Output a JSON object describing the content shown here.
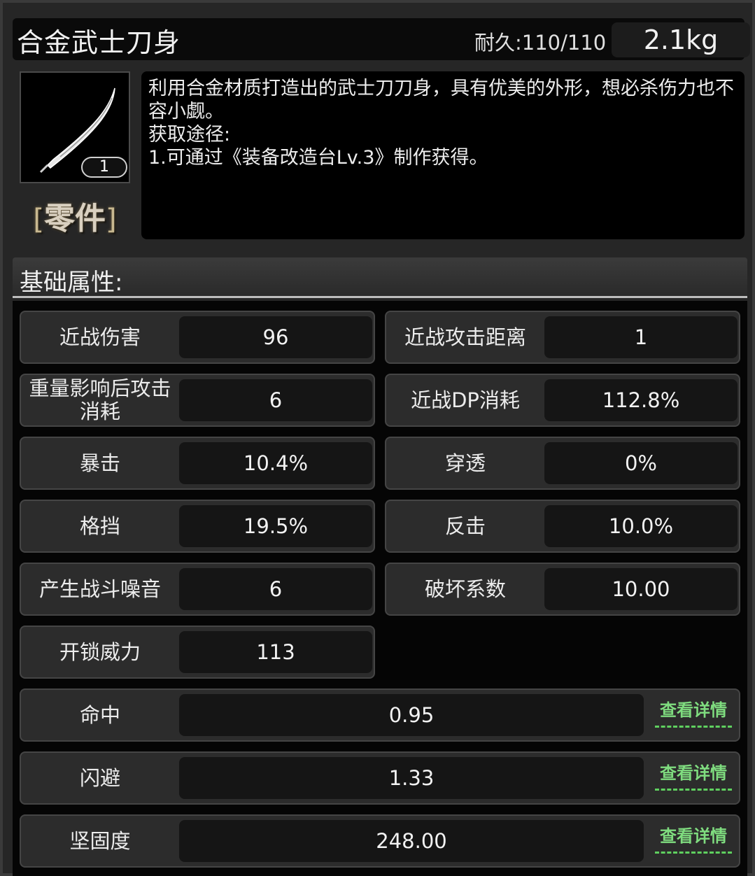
{
  "item": {
    "name": "合金武士刀身",
    "durability": "耐久:110/110",
    "weight": "2.1kg",
    "quantity": "1",
    "category_open": "[",
    "category": "零件",
    "category_close": "]",
    "description": "利用合金材质打造出的武士刀刀身，具有优美的外形，想必杀伤力也不容小觑。\n获取途径:\n1.可通过《装备改造台Lv.3》制作获得。",
    "icon": "katana-blade-icon"
  },
  "section": {
    "title": "基础属性:"
  },
  "stats": [
    {
      "label": "近战伤害",
      "value": "96"
    },
    {
      "label": "近战攻击距离",
      "value": "1"
    },
    {
      "label": "重量影响后攻击消耗",
      "value": "6"
    },
    {
      "label": "近战DP消耗",
      "value": "112.8%"
    },
    {
      "label": "暴击",
      "value": "10.4%"
    },
    {
      "label": "穿透",
      "value": "0%"
    },
    {
      "label": "格挡",
      "value": "19.5%"
    },
    {
      "label": "反击",
      "value": "10.0%"
    },
    {
      "label": "产生战斗噪音",
      "value": "6"
    },
    {
      "label": "破坏系数",
      "value": "10.00"
    },
    {
      "label": "开锁威力",
      "value": "113"
    }
  ],
  "detail_stats": [
    {
      "label": "命中",
      "value": "0.95",
      "link": "查看详情"
    },
    {
      "label": "闪避",
      "value": "1.33",
      "link": "查看详情"
    },
    {
      "label": "坚固度",
      "value": "248.00",
      "link": "查看详情"
    }
  ],
  "colors": {
    "link": "#7fdc7f",
    "background": "#262626",
    "panel": "#000000"
  }
}
